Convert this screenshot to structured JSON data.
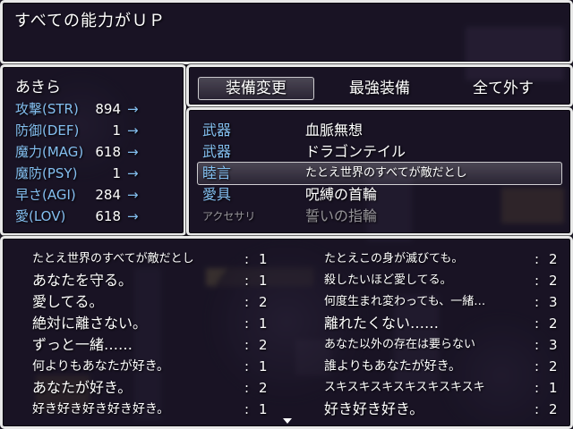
{
  "help": {
    "text": "すべての能力がＵＰ"
  },
  "actor": {
    "name": "あきら",
    "params": [
      {
        "label": "攻撃(STR)",
        "value": "894",
        "arrow": "→"
      },
      {
        "label": "防御(DEF)",
        "value": "1",
        "arrow": "→"
      },
      {
        "label": "魔力(MAG)",
        "value": "618",
        "arrow": "→"
      },
      {
        "label": "魔防(PSY)",
        "value": "1",
        "arrow": "→"
      },
      {
        "label": "早さ(AGI)",
        "value": "284",
        "arrow": "→"
      },
      {
        "label": "愛(LOV)",
        "value": "618",
        "arrow": "→"
      }
    ]
  },
  "commands": {
    "equip": "装備変更",
    "optimize": "最強装備",
    "clear": "全て外す"
  },
  "slots": [
    {
      "type": "武器",
      "item": "血脈無想"
    },
    {
      "type": "武器",
      "item": "ドラゴンテイル"
    },
    {
      "type": "睦言",
      "item": "たとえ世界のすべてが敵だとし"
    },
    {
      "type": "愛具",
      "item": "呪縛の首輪"
    },
    {
      "type": "アクセサリ",
      "item": "誓いの指輪"
    }
  ],
  "items": {
    "left": [
      {
        "name": "たとえ世界のすべてが敵だとし",
        "count": "1"
      },
      {
        "name": "あなたを守る。",
        "count": "1"
      },
      {
        "name": "愛してる。",
        "count": "2"
      },
      {
        "name": "絶対に離さない。",
        "count": "1"
      },
      {
        "name": "ずっと一緒……",
        "count": "2"
      },
      {
        "name": "何よりもあなたが好き。",
        "count": "1"
      },
      {
        "name": "あなたが好き。",
        "count": "2"
      },
      {
        "name": "好き好き好き好き好き。",
        "count": "1"
      }
    ],
    "right": [
      {
        "name": "たとえこの身が滅びても。",
        "count": "2"
      },
      {
        "name": "殺したいほど愛してる。",
        "count": "2"
      },
      {
        "name": "何度生まれ変わっても、一緒…",
        "count": "3"
      },
      {
        "name": "離れたくない……",
        "count": "2"
      },
      {
        "name": "あなた以外の存在は要らない",
        "count": "3"
      },
      {
        "name": "誰よりもあなたが好き。",
        "count": "2"
      },
      {
        "name": "スキスキスキスキスキスキスキ",
        "count": "1"
      },
      {
        "name": "好き好き好き。",
        "count": "2"
      }
    ],
    "sep": ":"
  },
  "colors": {
    "system_blue": "#84bff0",
    "window_border": "#e8e8e8",
    "window_bg": "#161222"
  }
}
